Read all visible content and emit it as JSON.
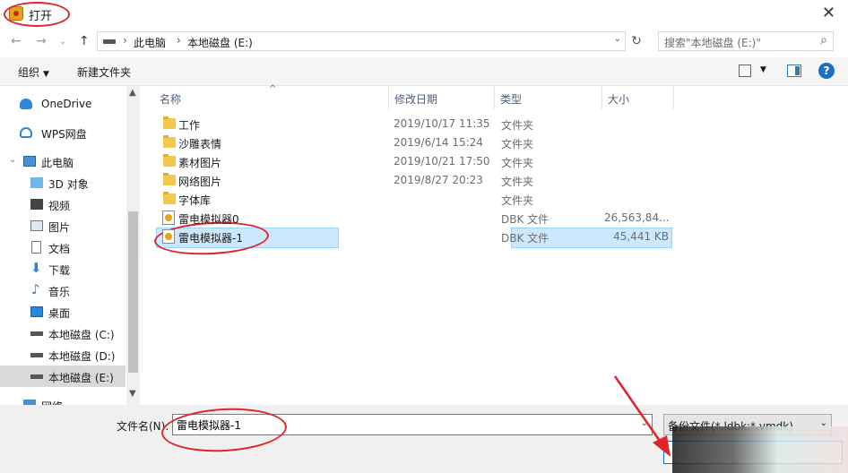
{
  "window": {
    "title": "打开"
  },
  "address": {
    "crumbs": [
      "此电脑",
      "本地磁盘 (E:)"
    ],
    "search_placeholder": "搜索\"本地磁盘 (E:)\""
  },
  "toolbar": {
    "organize": "组织",
    "new_folder": "新建文件夹"
  },
  "sidebar": {
    "items": [
      {
        "label": "OneDrive",
        "icon": "cloud-icon"
      },
      {
        "label": "WPS网盘",
        "icon": "cloud-icon"
      },
      {
        "label": "此电脑",
        "icon": "computer-icon"
      },
      {
        "label": "3D 对象",
        "icon": "cube-icon"
      },
      {
        "label": "视频",
        "icon": "video-icon"
      },
      {
        "label": "图片",
        "icon": "image-icon"
      },
      {
        "label": "文档",
        "icon": "document-icon"
      },
      {
        "label": "下载",
        "icon": "download-icon"
      },
      {
        "label": "音乐",
        "icon": "music-icon"
      },
      {
        "label": "桌面",
        "icon": "desktop-icon"
      },
      {
        "label": "本地磁盘 (C:)",
        "icon": "drive-icon"
      },
      {
        "label": "本地磁盘 (D:)",
        "icon": "drive-icon"
      },
      {
        "label": "本地磁盘 (E:)",
        "icon": "drive-icon",
        "selected": true
      },
      {
        "label": "网络",
        "icon": "network-icon"
      }
    ]
  },
  "files": {
    "columns": [
      "名称",
      "修改日期",
      "类型",
      "大小"
    ],
    "rows": [
      {
        "name": "工作",
        "date": "2019/10/17 11:35",
        "type": "文件夹",
        "size": ""
      },
      {
        "name": "沙雕表情",
        "date": "2019/6/14 15:24",
        "type": "文件夹",
        "size": ""
      },
      {
        "name": "素材图片",
        "date": "2019/10/21 17:50",
        "type": "文件夹",
        "size": ""
      },
      {
        "name": "网络图片",
        "date": "2019/8/27 20:23",
        "type": "文件夹",
        "size": ""
      },
      {
        "name": "字体库",
        "date": "",
        "type": "文件夹",
        "size": ""
      },
      {
        "name": "雷电模拟器0",
        "date": "",
        "type": "DBK 文件",
        "size": "26,563,84..."
      },
      {
        "name": "雷电模拟器-1",
        "date": "",
        "type": "DBK 文件",
        "size": "45,441 KB",
        "selected": true
      }
    ]
  },
  "bottom": {
    "filename_label": "文件名(N):",
    "filename_value": "雷电模拟器-1",
    "filter": "备份文件(*.ldbk;*.vmdk)"
  },
  "colors": {
    "selection": "#cce8ff",
    "accent": "#0078d7",
    "annotation": "#e0242a"
  }
}
